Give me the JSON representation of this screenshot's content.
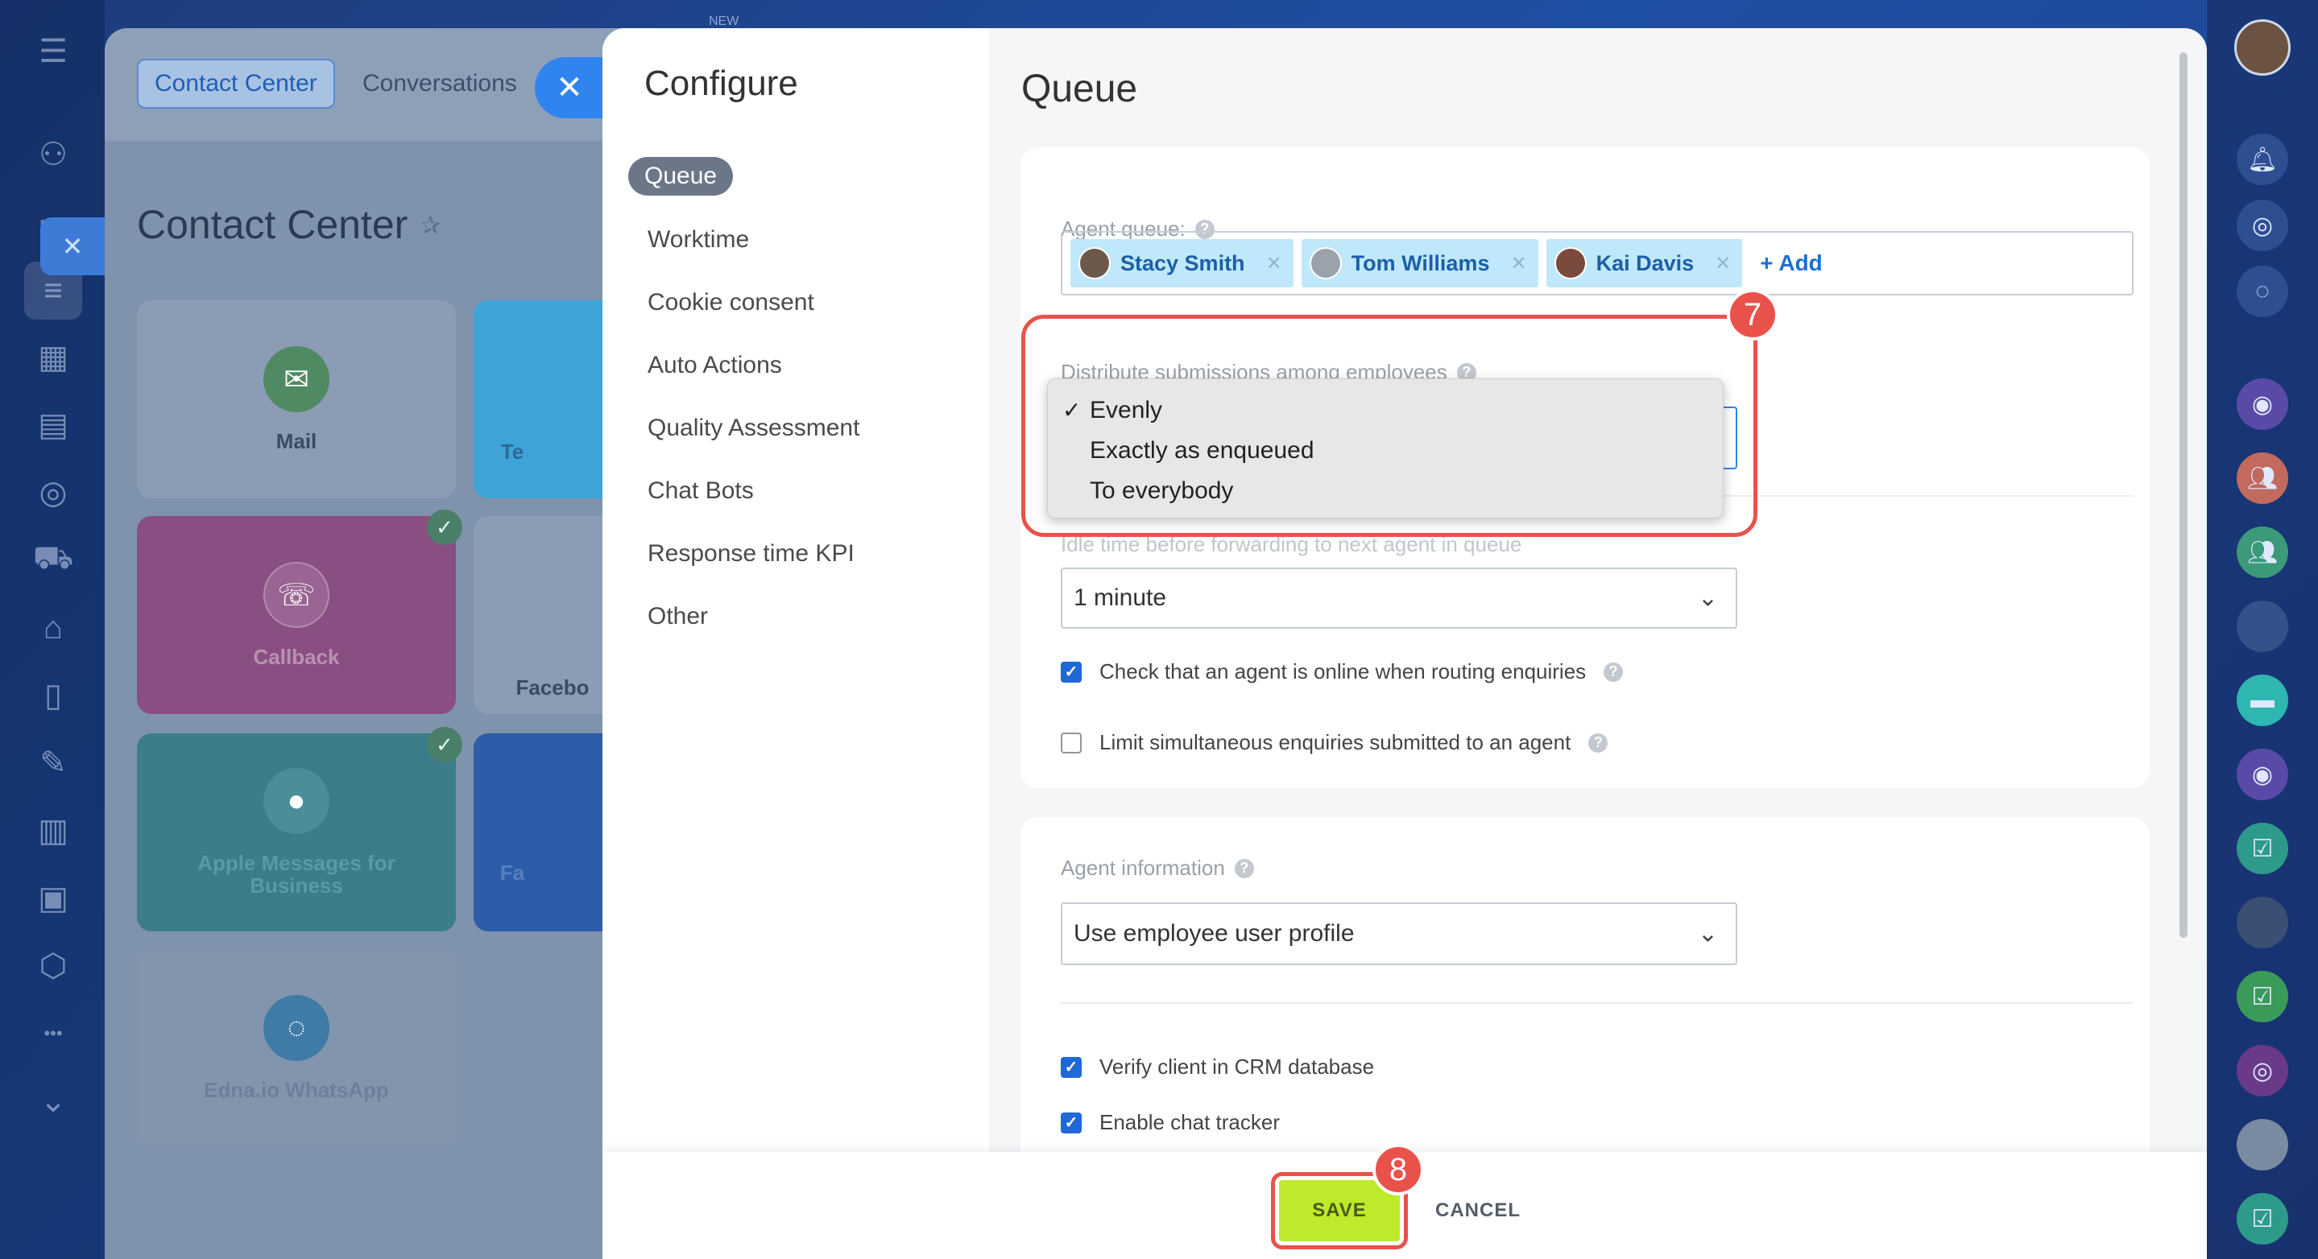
{
  "left_nav": {
    "icons": [
      "menu-icon",
      "network-icon",
      "chat-icon",
      "contact-center-icon",
      "calendar-icon",
      "storage-icon",
      "target-icon",
      "cart-icon",
      "robot-icon",
      "document-icon",
      "signature-icon",
      "analytics-icon",
      "invoice-icon",
      "box-icon",
      "more-icon",
      "chevron-down-icon"
    ]
  },
  "background": {
    "tabs": [
      "Contact Center",
      "Conversations"
    ],
    "title": "Contact Center",
    "tiles": [
      {
        "label": "Mail",
        "color": "#5f8a6f",
        "icon": "mail-icon"
      },
      {
        "label": "Te",
        "color": "#3ea4d8",
        "icon": ""
      },
      {
        "label": "Callback",
        "color": "#8a4f82",
        "icon": "phone-icon"
      },
      {
        "label": "Facebo",
        "color": "#7f93ad",
        "icon": ""
      },
      {
        "label": "Apple Messages for Business",
        "color": "#3b7d8a",
        "icon": "message-icon"
      },
      {
        "label": "Fa",
        "color": "#2d5ca8",
        "icon": ""
      },
      {
        "label": "Edna.io WhatsApp",
        "color": "#7f93ad",
        "icon": "edna-icon"
      }
    ],
    "new_badge": "NEW"
  },
  "configure": {
    "title": "Configure",
    "menu": [
      "Queue",
      "Worktime",
      "Cookie consent",
      "Auto Actions",
      "Quality Assessment",
      "Chat Bots",
      "Response time KPI",
      "Other"
    ],
    "active_index": 0
  },
  "queue": {
    "title": "Queue",
    "agent_queue_label": "Agent queue:",
    "agents": [
      "Stacy Smith",
      "Tom Williams",
      "Kai Davis"
    ],
    "add_label": "+ Add",
    "distribute_label": "Distribute submissions among employees",
    "distribute_options": [
      "Evenly",
      "Exactly as enqueued",
      "To everybody"
    ],
    "distribute_selected": "Evenly",
    "idle_label": "Idle time before forwarding to next agent in queue",
    "idle_value": "1 minute",
    "check_online_label": "Check that an agent is online when routing enquiries",
    "check_online": true,
    "limit_label": "Limit simultaneous enquiries submitted to an agent",
    "limit": false
  },
  "agent_info": {
    "label": "Agent information",
    "value": "Use employee user profile",
    "verify_label": "Verify client in CRM database",
    "verify": true,
    "tracker_label": "Enable chat tracker",
    "tracker": true
  },
  "annotations": [
    "7",
    "8"
  ],
  "footer": {
    "save_label": "SAVE",
    "cancel_label": "CANCEL"
  },
  "colors": {
    "accent": "#2067d8",
    "annotation": "#e9524a",
    "save": "#bdea2a"
  }
}
